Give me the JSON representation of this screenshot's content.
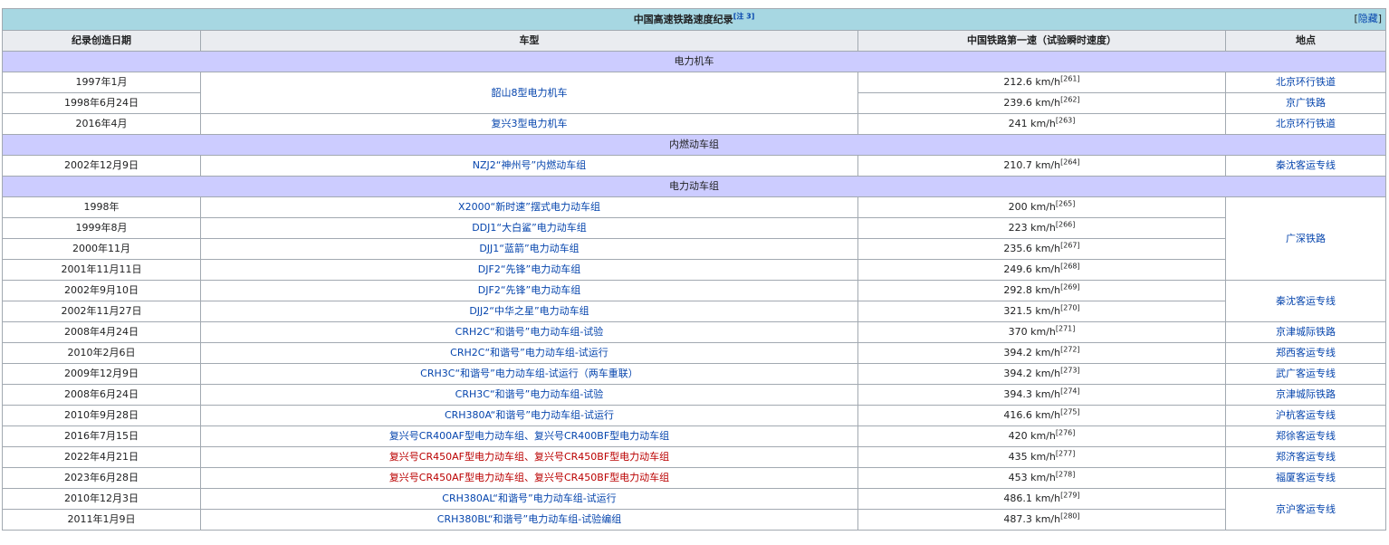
{
  "table": {
    "title": "中国高速铁路速度纪录",
    "title_note": "[注 3]",
    "hide_label": "隐藏",
    "headers": [
      "纪录创造日期",
      "车型",
      "中国铁路第一速（试验瞬时速度）",
      "地点"
    ],
    "groups": {
      "g1": "电力机车",
      "g2": "内燃动车组",
      "g3": "电力动车组"
    },
    "rows": [
      {
        "date": "1997年1月",
        "model": "韶山8型电力机车",
        "speed": "212.6 km/h",
        "ref": "[261]",
        "place": "北京环行铁道"
      },
      {
        "date": "1998年6月24日",
        "speed": "239.6 km/h",
        "ref": "[262]",
        "place": "京广铁路"
      },
      {
        "date": "2016年4月",
        "model": "复兴3型电力机车",
        "speed": "241 km/h",
        "ref": "[263]",
        "place": "北京环行铁道"
      },
      {
        "date": "2002年12月9日",
        "model": "NZJ2“神州号”内燃动车组",
        "speed": "210.7 km/h",
        "ref": "[264]",
        "place": "秦沈客运专线"
      },
      {
        "date": "1998年",
        "model": "X2000“新时速”摆式电力动车组",
        "speed": "200 km/h",
        "ref": "[265]",
        "place": "广深铁路"
      },
      {
        "date": "1999年8月",
        "model": "DDJ1“大白鲨”电力动车组",
        "speed": "223 km/h",
        "ref": "[266]"
      },
      {
        "date": "2000年11月",
        "model": "DJJ1“蓝箭”电力动车组",
        "speed": "235.6 km/h",
        "ref": "[267]"
      },
      {
        "date": "2001年11月11日",
        "model": "DJF2“先锋”电力动车组",
        "speed": "249.6 km/h",
        "ref": "[268]"
      },
      {
        "date": "2002年9月10日",
        "model": "DJF2“先锋”电力动车组",
        "speed": "292.8 km/h",
        "ref": "[269]",
        "place": "秦沈客运专线"
      },
      {
        "date": "2002年11月27日",
        "model": "DJJ2“中华之星”电力动车组",
        "speed": "321.5 km/h",
        "ref": "[270]"
      },
      {
        "date": "2008年4月24日",
        "model": "CRH2C“和谐号”电力动车组-试验",
        "speed": "370 km/h",
        "ref": "[271]",
        "place": "京津城际铁路"
      },
      {
        "date": "2010年2月6日",
        "model": "CRH2C“和谐号”电力动车组-试运行",
        "speed": "394.2 km/h",
        "ref": "[272]",
        "place": "郑西客运专线"
      },
      {
        "date": "2009年12月9日",
        "model": "CRH3C“和谐号”电力动车组-试运行（两车重联）",
        "speed": "394.2 km/h",
        "ref": "[273]",
        "place": "武广客运专线"
      },
      {
        "date": "2008年6月24日",
        "model": "CRH3C“和谐号”电力动车组-试验",
        "speed": "394.3 km/h",
        "ref": "[274]",
        "place": "京津城际铁路"
      },
      {
        "date": "2010年9月28日",
        "model": "CRH380A“和谐号”电力动车组-试运行",
        "speed": "416.6 km/h",
        "ref": "[275]",
        "place": "沪杭客运专线"
      },
      {
        "date": "2016年7月15日",
        "model": "复兴号CR400AF型电力动车组、复兴号CR400BF型电力动车组",
        "speed": "420 km/h",
        "ref": "[276]",
        "place": "郑徐客运专线"
      },
      {
        "date": "2022年4月21日",
        "model": "复兴号CR450AF型电力动车组、复兴号CR450BF型电力动车组",
        "speed": "435 km/h",
        "ref": "[277]",
        "place": "郑济客运专线"
      },
      {
        "date": "2023年6月28日",
        "model": "复兴号CR450AF型电力动车组、复兴号CR450BF型电力动车组",
        "speed": "453 km/h",
        "ref": "[278]",
        "place": "福厦客运专线"
      },
      {
        "date": "2010年12月3日",
        "model": "CRH380AL“和谐号”电力动车组-试运行",
        "speed": "486.1 km/h",
        "ref": "[279]",
        "place": "京沪客运专线"
      },
      {
        "date": "2011年1月9日",
        "model": "CRH380BL“和谐号”电力动车组-试验编组",
        "speed": "487.3 km/h",
        "ref": "[280]"
      }
    ]
  }
}
